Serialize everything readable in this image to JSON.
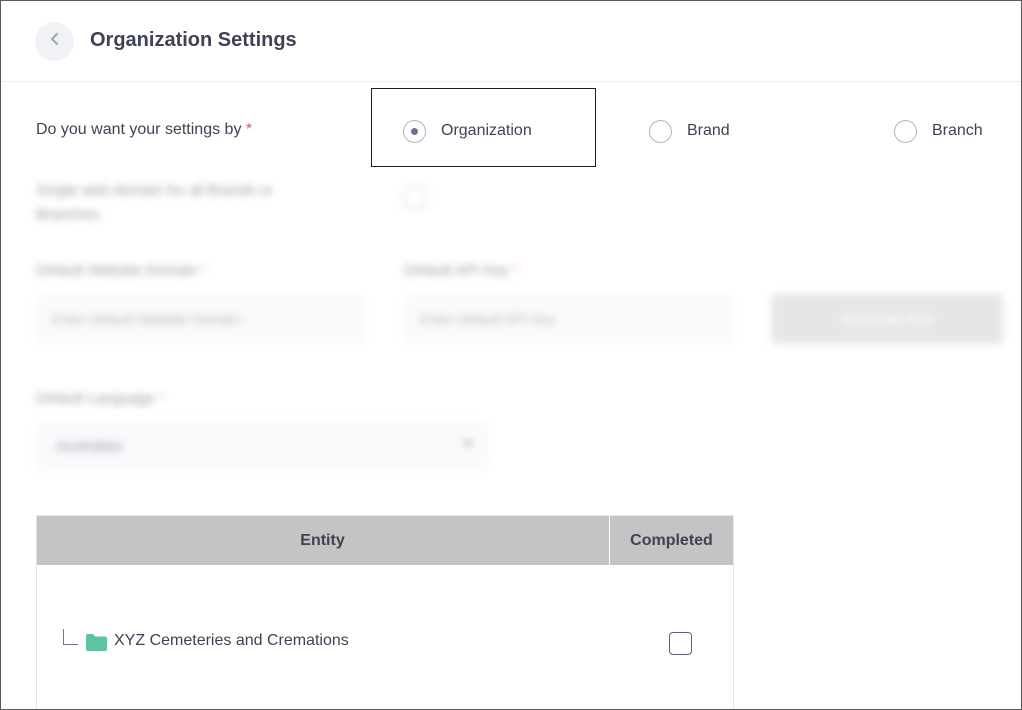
{
  "header": {
    "back_icon": "chevron-left-icon",
    "title": "Organization Settings"
  },
  "settings_by": {
    "label": "Do you want your settings by",
    "required_mark": "*",
    "options": [
      {
        "label": "Organization",
        "checked": true
      },
      {
        "label": "Brand",
        "checked": false
      },
      {
        "label": "Branch",
        "checked": false
      }
    ]
  },
  "form": {
    "single_domain_label": "Single web domain for all Brands or Branches",
    "website_domain_label": "Default Website Domain",
    "website_domain_placeholder": "Enter Default Website Domain",
    "api_key_label": "Default API Key",
    "api_key_placeholder": "Enter Default API Key",
    "generate_button": "Generate Key",
    "language_label": "Default Language",
    "language_value": "Australian",
    "required_mark": "*"
  },
  "entity_table": {
    "columns": [
      "Entity",
      "Completed"
    ],
    "rows": [
      {
        "name": "XYZ Cemeteries and Cremations",
        "icon": "folder-icon",
        "completed": false
      }
    ]
  },
  "colors": {
    "accent_required": "#f64e60",
    "folder": "#5fc2a3",
    "table_header": "#c4c4c4"
  }
}
